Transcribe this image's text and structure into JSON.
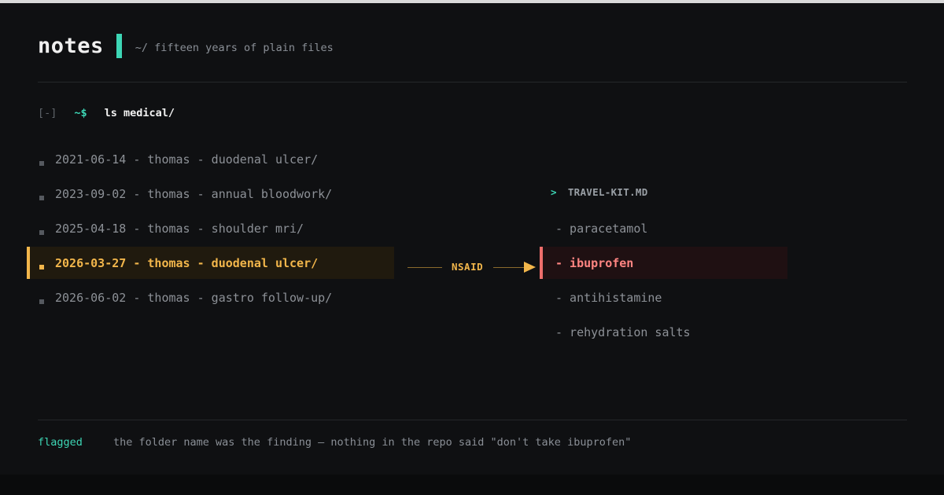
{
  "header": {
    "title": "notes",
    "subtitle": "~/ fifteen years of plain files"
  },
  "prompt": {
    "collapse": "[-]",
    "symbol": "~$",
    "command": "ls medical/"
  },
  "folders": [
    {
      "label": "2021-06-14 - thomas - duodenal ulcer/",
      "highlighted": false
    },
    {
      "label": "2023-09-02 - thomas - annual bloodwork/",
      "highlighted": false
    },
    {
      "label": "2025-04-18 - thomas - shoulder mri/",
      "highlighted": false
    },
    {
      "label": "2026-03-27 - thomas - duodenal ulcer/",
      "highlighted": true
    },
    {
      "label": "2026-06-02 - thomas - gastro follow-up/",
      "highlighted": false
    }
  ],
  "connector": {
    "label": "NSAID"
  },
  "kit": {
    "chevron": ">",
    "title": "TRAVEL-KIT.MD",
    "items": [
      {
        "label": "- paracetamol",
        "flagged": false
      },
      {
        "label": "- ibuprofen",
        "flagged": true
      },
      {
        "label": "- antihistamine",
        "flagged": false
      },
      {
        "label": "- rehydration salts",
        "flagged": false
      }
    ]
  },
  "footer": {
    "tag": "flagged",
    "note": "the folder name was the finding — nothing in the repo said \"don't take ibuprofen\""
  },
  "colors": {
    "accent": "#3dd6b5",
    "highlight": "#f2b64b",
    "alert": "#ee6e6b",
    "background": "#0f1012"
  }
}
